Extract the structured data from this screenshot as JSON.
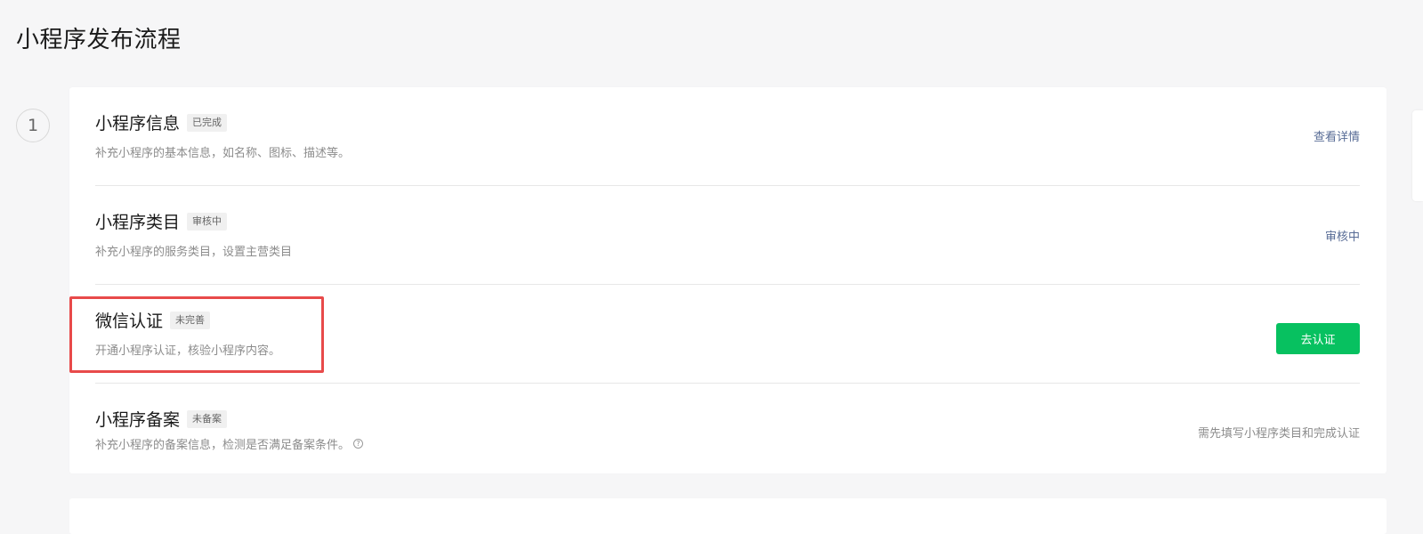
{
  "page": {
    "title": "小程序发布流程"
  },
  "step": {
    "number": "1"
  },
  "rows": [
    {
      "title": "小程序信息",
      "badge": "已完成",
      "desc": "补充小程序的基本信息，如名称、图标、描述等。",
      "action": "查看详情"
    },
    {
      "title": "小程序类目",
      "badge": "审核中",
      "desc": "补充小程序的服务类目，设置主营类目",
      "action": "审核中"
    },
    {
      "title": "微信认证",
      "badge": "未完善",
      "desc": "开通小程序认证，核验小程序内容。",
      "action": "去认证"
    },
    {
      "title": "小程序备案",
      "badge": "未备案",
      "desc": "补充小程序的备案信息，检测是否满足备案条件。",
      "action": "需先填写小程序类目和完成认证"
    }
  ],
  "icons": {
    "help": "question-circle-icon"
  },
  "colors": {
    "link": "#576b95",
    "primary": "#07c160",
    "highlight": "#e84a4a",
    "background": "#f6f6f7"
  }
}
